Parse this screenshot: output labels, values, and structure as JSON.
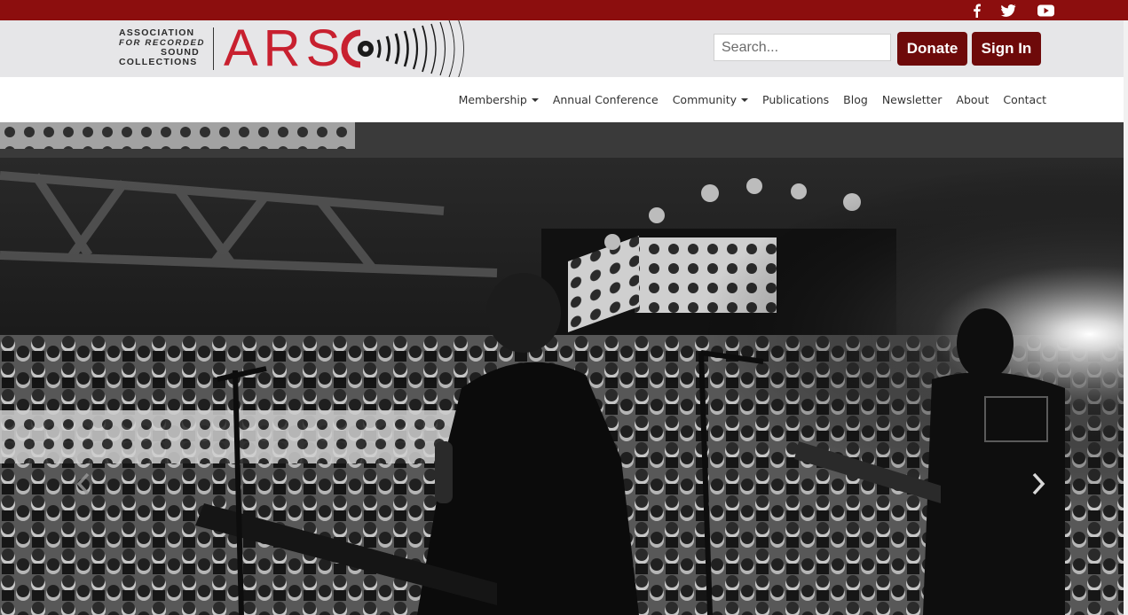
{
  "social": {
    "icons": [
      "facebook-icon",
      "twitter-icon",
      "youtube-icon"
    ],
    "color": "#ffffff",
    "bar_color": "#8c0e0e"
  },
  "logo": {
    "line1": "ASSOCIATION",
    "line2": "FOR RECORDED",
    "line3": "SOUND",
    "line4": "COLLECTIONS",
    "wordmark": "ARS",
    "accent": "#c8202f"
  },
  "search": {
    "placeholder": "Search..."
  },
  "header_buttons": {
    "donate": "Donate",
    "sign_in": "Sign In",
    "color": "#6e0a0a"
  },
  "nav": {
    "items": [
      {
        "label": "Membership",
        "dropdown": true
      },
      {
        "label": "Annual Conference",
        "dropdown": false
      },
      {
        "label": "Community",
        "dropdown": true
      },
      {
        "label": "Publications",
        "dropdown": false
      },
      {
        "label": "Blog",
        "dropdown": false
      },
      {
        "label": "Newsletter",
        "dropdown": false
      },
      {
        "label": "About",
        "dropdown": false
      },
      {
        "label": "Contact",
        "dropdown": false
      }
    ]
  },
  "hero": {
    "image": "black-and-white concert photo",
    "controls": [
      "chevron-left-icon",
      "chevron-right-icon"
    ]
  }
}
